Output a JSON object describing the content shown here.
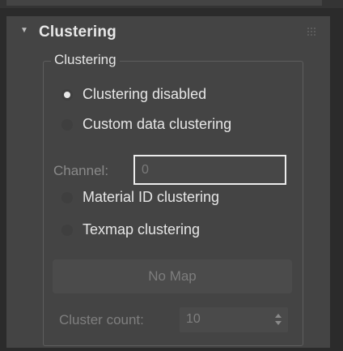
{
  "rollout": {
    "title": "Clustering",
    "caret_icon": "chevron-down-icon",
    "grip_icon": "drag-grip-icon"
  },
  "group": {
    "label": "Clustering"
  },
  "radios": [
    {
      "label": "Clustering disabled",
      "selected": true
    },
    {
      "label": "Custom data clustering",
      "selected": false
    },
    {
      "label": "Material ID clustering",
      "selected": false
    },
    {
      "label": "Texmap clustering",
      "selected": false
    }
  ],
  "channel": {
    "label": "Channel:",
    "value": "0"
  },
  "map_button": {
    "label": "No Map"
  },
  "cluster_count": {
    "label": "Cluster count:",
    "value": "10"
  }
}
